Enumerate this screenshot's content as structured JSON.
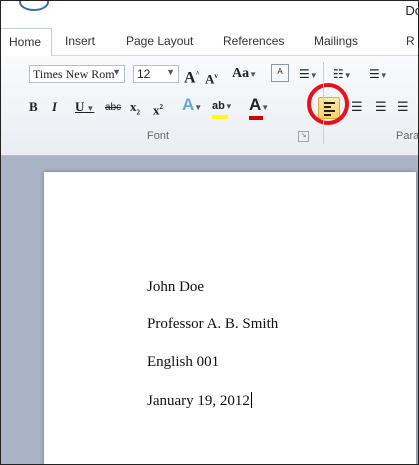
{
  "window": {
    "title_fragment": "Do"
  },
  "tabs": [
    {
      "label": "Home",
      "active": true
    },
    {
      "label": "Insert"
    },
    {
      "label": "Page Layout"
    },
    {
      "label": "References"
    },
    {
      "label": "Mailings"
    },
    {
      "label": "R"
    }
  ],
  "ribbon": {
    "font": {
      "font_name": "Times New Rom",
      "font_size": "12",
      "group_label": "Font",
      "buttons": {
        "grow": "A",
        "shrink": "A",
        "change_case": "Aa",
        "bold": "B",
        "italic": "I",
        "underline": "U",
        "strike": "abc",
        "subscript": "x",
        "superscript": "x",
        "text_effects": "A",
        "highlight": "ab",
        "font_color": "A"
      }
    },
    "paragraph": {
      "group_label": "Para",
      "align_left_active": true
    }
  },
  "colors": {
    "highlight_circle": "#e8101a",
    "active_button": "#ffd36b",
    "font_color_bar": "#d00000",
    "highlight_bar": "#ffff00",
    "workspace": "#a9b4c6"
  },
  "document": {
    "lines": [
      "John Doe",
      "Professor A. B. Smith",
      "English 001",
      "January 19, 2012"
    ]
  }
}
